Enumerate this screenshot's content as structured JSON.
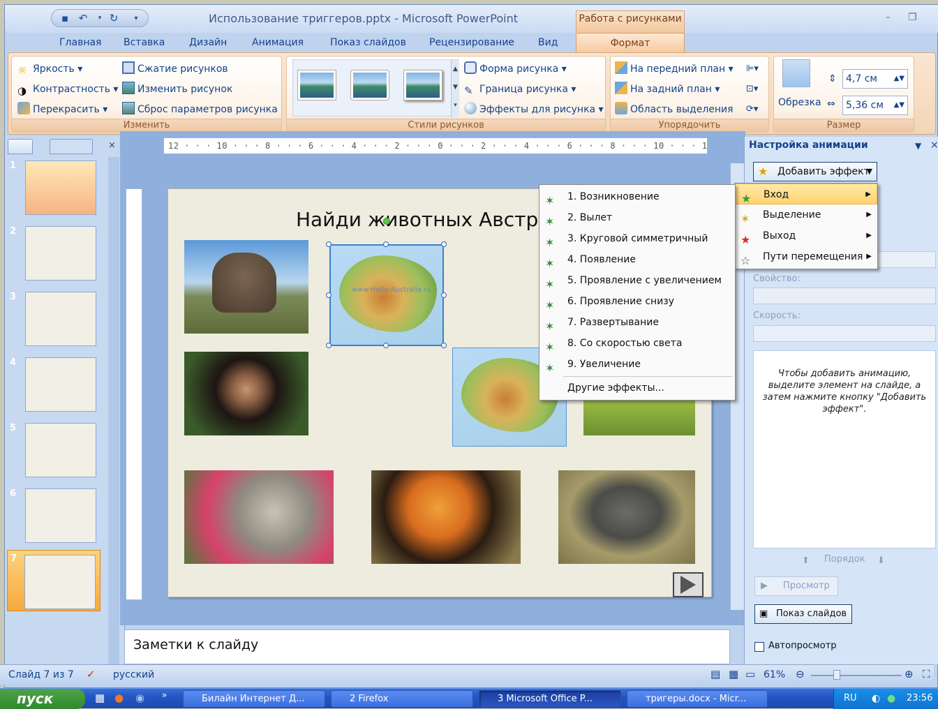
{
  "window": {
    "title": "Использование триггеров.pptx - Microsoft PowerPoint",
    "tool_tab_header": "Работа с рисунками"
  },
  "tabs": [
    "Главная",
    "Вставка",
    "Дизайн",
    "Анимация",
    "Показ слайдов",
    "Рецензирование",
    "Вид",
    "Формат"
  ],
  "ribbon": {
    "adjust": {
      "label": "Изменить",
      "brightness": "Яркость",
      "contrast": "Контрастность",
      "recolor": "Перекрасить",
      "compress": "Сжатие рисунков",
      "change": "Изменить рисунок",
      "reset": "Сброс параметров рисунка"
    },
    "styles": {
      "label": "Стили рисунков",
      "shape": "Форма рисунка",
      "border": "Граница рисунка",
      "effects": "Эффекты для рисунка"
    },
    "arrange": {
      "label": "Упорядочить",
      "front": "На передний план",
      "back": "На задний план",
      "selection": "Область выделения"
    },
    "size": {
      "label": "Размер",
      "crop": "Обрезка",
      "height": "4,7 см",
      "width": "5,36 см"
    }
  },
  "ruler_text": "12 · · · 10 · · · 8 · · · 6 · · · 4 · · · 2 · · · 0 · · · 2 · · · 4 · · · 6 · · · 8 · · · 10 · · · 12",
  "slides": [
    "1",
    "2",
    "3",
    "4",
    "5",
    "6",
    "7"
  ],
  "slide": {
    "title": "Найди животных Австра",
    "watermark": "www.Hello-Australia.ru"
  },
  "notes_placeholder": "Заметки к слайду",
  "status": {
    "slide_info": "Слайд 7 из 7",
    "language": "русский",
    "zoom": "61%"
  },
  "animation_pane": {
    "title": "Настройка анимации",
    "add_effect": "Добавить эффект",
    "property_label": "Свойство:",
    "speed_label": "Скорость:",
    "hint": "Чтобы добавить анимацию, выделите элемент на слайде, а затем нажмите кнопку \"Добавить эффект\".",
    "order": "Порядок",
    "preview": "Просмотр",
    "slideshow": "Показ слайдов",
    "autopreview": "Автопросмотр"
  },
  "add_effect_menu": [
    "Вход",
    "Выделение",
    "Выход",
    "Пути перемещения"
  ],
  "entrance_menu": [
    "1. Возникновение",
    "2. Вылет",
    "3. Круговой симметричный",
    "4. Появление",
    "5. Проявление с увеличением",
    "6. Проявление снизу",
    "7. Развертывание",
    "8. Со скоростью света",
    "9. Увеличение",
    "Другие эффекты..."
  ],
  "taskbar": {
    "start": "пуск",
    "tasks": [
      "Билайн Интернет Д...",
      "2 Firefox",
      "3 Microsoft Office P...",
      "тригеры.docx - Micr..."
    ],
    "lang": "RU",
    "clock": "23:56"
  },
  "colors": {
    "accent": "#f6a93c",
    "ribbon_text": "#15428b",
    "tool_tab": "#f7c79b"
  }
}
